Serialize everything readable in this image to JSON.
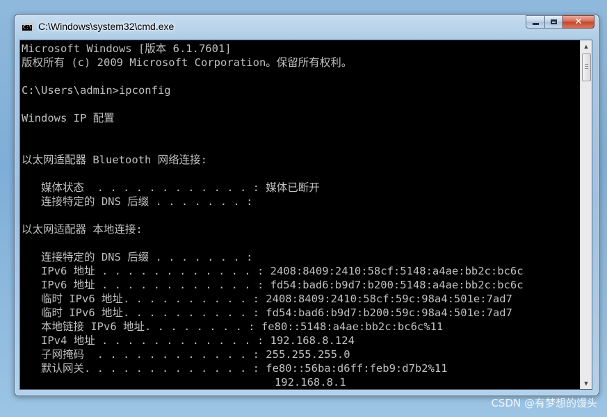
{
  "window": {
    "title": "C:\\Windows\\system32\\cmd.exe",
    "controls": {
      "minimize_icon": "minimize-icon",
      "maximize_icon": "maximize-icon",
      "close_icon": "close-icon",
      "close_glyph": "✕"
    }
  },
  "console": {
    "background": "#000000",
    "foreground": "#c0c0c0",
    "lines": [
      "Microsoft Windows [版本 6.1.7601]",
      "版权所有 (c) 2009 Microsoft Corporation。保留所有权利。",
      "",
      "C:\\Users\\admin>ipconfig",
      "",
      "Windows IP 配置",
      "",
      "",
      "以太网适配器 Bluetooth 网络连接:",
      "",
      "   媒体状态  . . . . . . . . . . . . : 媒体已断开",
      "   连接特定的 DNS 后缀 . . . . . . . :",
      "",
      "以太网适配器 本地连接:",
      "",
      "   连接特定的 DNS 后缀 . . . . . . . :",
      "   IPv6 地址 . . . . . . . . . . . . : 2408:8409:2410:58cf:5148:a4ae:bb2c:bc6c",
      "   IPv6 地址 . . . . . . . . . . . . : fd54:bad6:b9d7:b200:5148:a4ae:bb2c:bc6c",
      "   临时 IPv6 地址. . . . . . . . . . : 2408:8409:2410:58cf:59c:98a4:501e:7ad7",
      "   临时 IPv6 地址. . . . . . . . . . : fd54:bad6:b9d7:b200:59c:98a4:501e:7ad7",
      "   本地链接 IPv6 地址. . . . . . . . : fe80::5148:a4ae:bb2c:bc6c%11",
      "   IPv4 地址 . . . . . . . . . . . . : 192.168.8.124",
      "   子网掩码  . . . . . . . . . . . . : 255.255.255.0",
      "   默认网关. . . . . . . . . . . . . : fe80::56ba:d6ff:feb9:d7b2%11",
      "                                       192.168.8.1"
    ]
  },
  "scrollbar": {
    "up_glyph": "▲",
    "down_glyph": "▼"
  },
  "watermark": "CSDN @有梦想的馒头"
}
